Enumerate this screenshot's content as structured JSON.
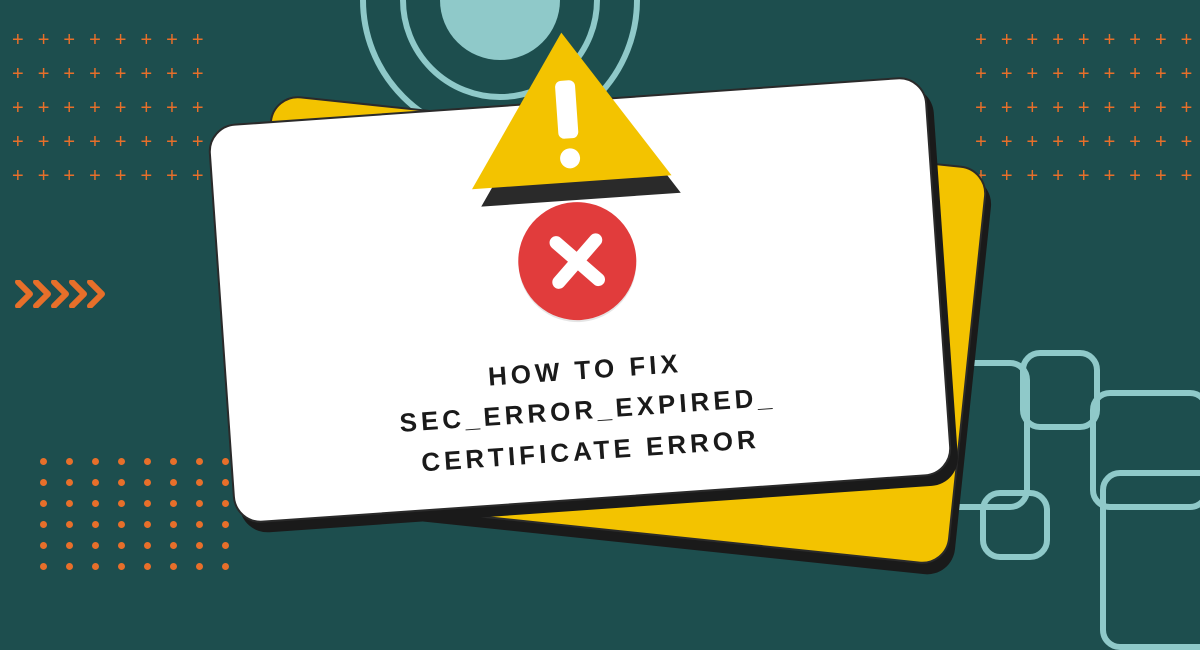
{
  "headline": {
    "line1": "HOW TO FIX",
    "line2": "SEC_ERROR_EXPIRED_",
    "line3": "CERTIFICATE ERROR"
  },
  "decor": {
    "plus_glyph": "+",
    "chevron_color": "#e76f2a",
    "dot_color": "#e76f2a",
    "ring_color": "#8fc9c9",
    "card_accent": "#f3c300",
    "error_circle_color": "#e13c3c"
  }
}
